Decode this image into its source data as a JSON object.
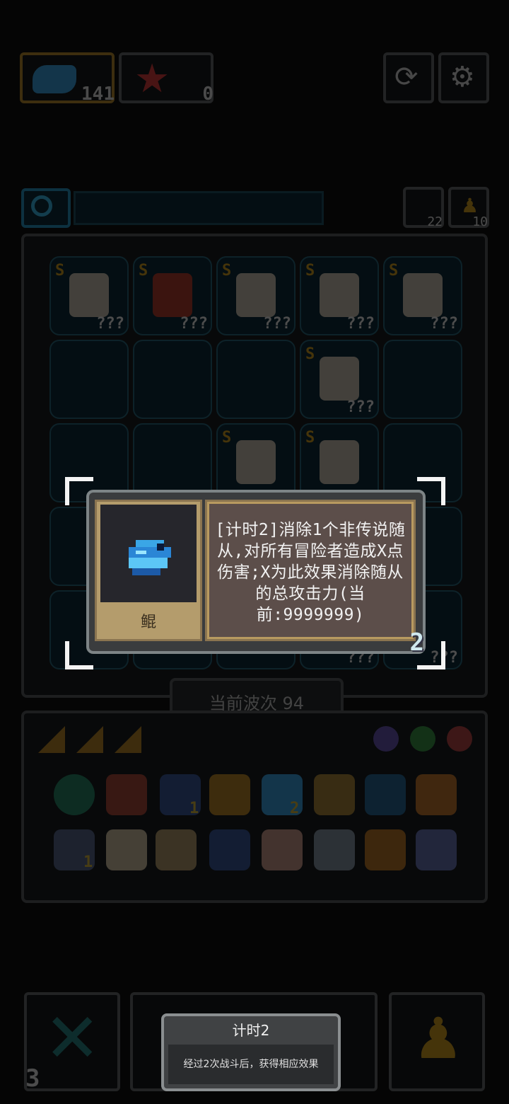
{
  "currency": {
    "fish_count": "141",
    "star_count": "0"
  },
  "board": {
    "hero_labels": [
      "???",
      "???",
      "???",
      "???",
      "???",
      "???",
      "???",
      "???",
      "???"
    ],
    "corner_counts": {
      "left": "22",
      "right": "10"
    },
    "wave_label": "当前波次 94",
    "s_badge": "S"
  },
  "items": {
    "count_1": "1",
    "count_2": "2",
    "count_3": "1"
  },
  "tooltip": {
    "item_name": "鲲",
    "description": "[计时2]消除1个非传说随从,对所有冒险者造成X点伤害;X为此效果消除随从的总攻击力(当前:9999999)",
    "stack_count": "2"
  },
  "bottom": {
    "left_count": "3"
  },
  "popup": {
    "title": "计时2",
    "body": "经过2次战斗后，获得相应效果"
  },
  "colors": {
    "fish_blue": "#3aa6e6",
    "gold": "#d9a21e",
    "teal_cell": "#0e2c3a"
  }
}
